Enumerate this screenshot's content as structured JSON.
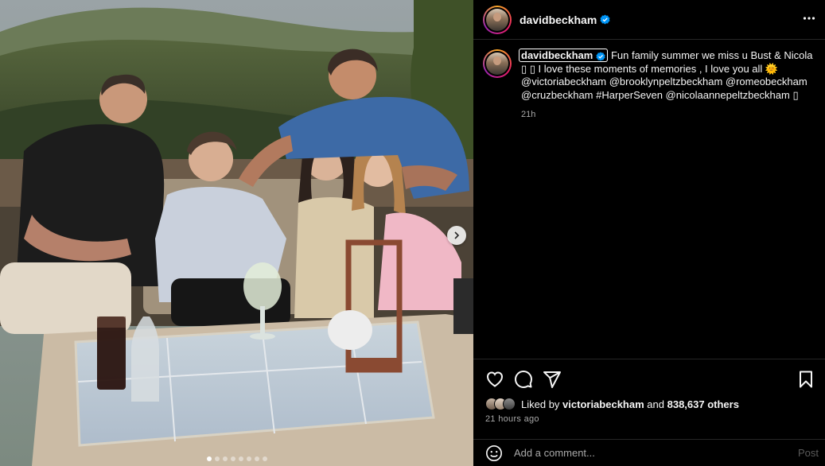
{
  "post": {
    "username": "davidbeckham",
    "caption_text": "Fun family summer we miss u Bust & Nicola ▯ ▯ I love these moments of memories , I love you all 🌞 @victoriabeckham @brooklynpeltzbeckham @romeobeckham @cruzbeckham #HarperSeven @nicolaannepeltzbeckham ▯",
    "caption_time": "21h",
    "liked_by_prefix": "Liked by",
    "liked_by_user": "victoriabeckham",
    "liked_by_and": "and",
    "likes_others": "838,637 others",
    "time_ago": "21 hours ago"
  },
  "comment": {
    "placeholder": "Add a comment...",
    "post_label": "Post"
  },
  "carousel": {
    "total_slides": 8,
    "active_slide": 1
  },
  "icons": {
    "verified": "verified-badge-icon",
    "more": "more-options-icon",
    "like": "heart-icon",
    "comment": "comment-icon",
    "share": "share-icon",
    "save": "bookmark-icon",
    "emoji": "emoji-icon",
    "next": "chevron-right-icon"
  },
  "colors": {
    "background": "#000000",
    "text": "#f5f5f5",
    "muted": "#a8a8a8",
    "verified": "#0095f6",
    "divider": "#262626"
  }
}
